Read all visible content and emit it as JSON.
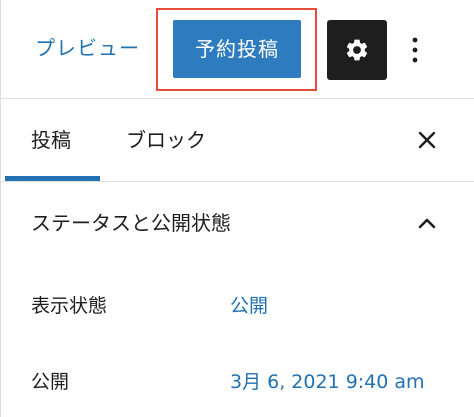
{
  "header": {
    "preview_label": "プレビュー",
    "schedule_label": "予約投稿",
    "settings_icon": "gear-icon",
    "more_icon": "vertical-ellipsis-icon"
  },
  "tabs": [
    {
      "label": "投稿",
      "active": true
    },
    {
      "label": "ブロック",
      "active": false
    }
  ],
  "close_icon": "close-icon",
  "status_panel": {
    "title": "ステータスと公開状態",
    "expanded": true,
    "visibility": {
      "label": "表示状態",
      "value": "公開"
    },
    "publish": {
      "label": "公開",
      "value": "3月 6, 2021 9:40 am"
    }
  },
  "colors": {
    "accent": "#2271b1",
    "primary_button": "#2f7bbf",
    "highlight": "#e74c3c",
    "dark": "#1e1e1e"
  }
}
